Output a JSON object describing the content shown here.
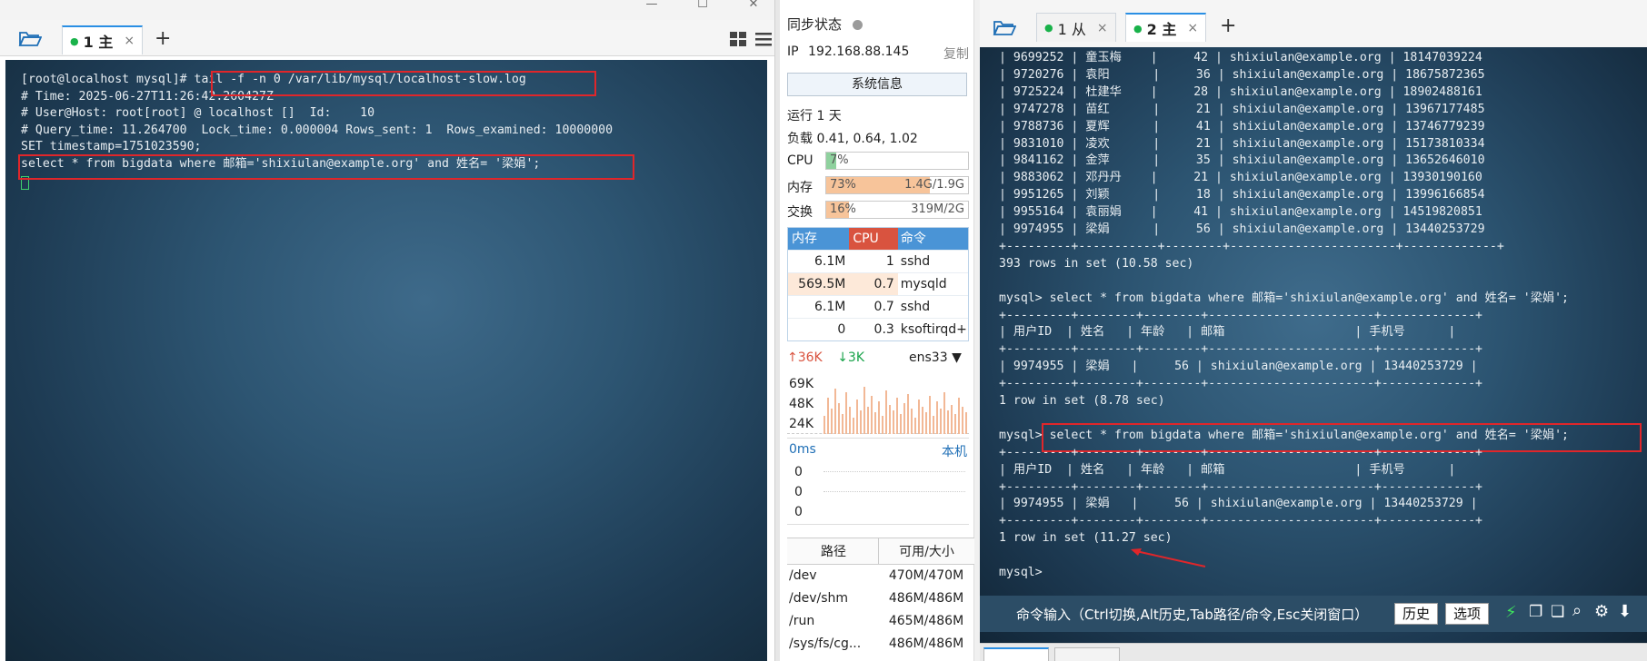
{
  "left": {
    "tab": {
      "label": "1 主",
      "close": "×"
    },
    "plus": "+",
    "lines": [
      "[root@localhost mysql]# tail -f -n 0 /var/lib/mysql/localhost-slow.log",
      "# Time: 2025-06-27T11:26:42.260427Z",
      "# User@Host: root[root] @ localhost []  Id:    10",
      "# Query_time: 11.264700  Lock_time: 0.000004 Rows_sent: 1  Rows_examined: 10000000",
      "SET timestamp=1751023590;",
      "select * from bigdata where 邮箱='shixiulan@example.org' and 姓名= '梁娟';"
    ]
  },
  "mid": {
    "sync_label": "同步状态",
    "ip_label": "IP",
    "ip": "192.168.88.145",
    "copy": "复制",
    "sysinfo_button": "系统信息",
    "uptime": "运行 1 天",
    "load": "负载 0.41, 0.64, 1.02",
    "cpu": {
      "label": "CPU",
      "pct": "7%",
      "fill": 0.07
    },
    "mem": {
      "label": "内存",
      "pct": "73%",
      "detail": "1.4G/1.9G",
      "fill": 0.73
    },
    "swap": {
      "label": "交换",
      "pct": "16%",
      "detail": "319M/2G",
      "fill": 0.16
    },
    "proc_headers": [
      "内存",
      "CPU",
      "命令"
    ],
    "procs": [
      {
        "mem": "6.1M",
        "cpu": "1",
        "cmd": "sshd"
      },
      {
        "mem": "569.5M",
        "cpu": "0.7",
        "cmd": "mysqld"
      },
      {
        "mem": "6.1M",
        "cpu": "0.7",
        "cmd": "sshd"
      },
      {
        "mem": "0",
        "cpu": "0.3",
        "cmd": "ksoftirqd+"
      }
    ],
    "net": {
      "up": "36K",
      "down": "3K",
      "iface": "ens33",
      "ticks": [
        "69K",
        "48K",
        "24K"
      ]
    },
    "latency": {
      "label": "0ms",
      "host": "本机",
      "values": [
        "0",
        "0",
        "0"
      ]
    },
    "disk_headers": [
      "路径",
      "可用/大小"
    ],
    "disks": [
      {
        "path": "/dev",
        "size": "470M/470M"
      },
      {
        "path": "/dev/shm",
        "size": "486M/486M"
      },
      {
        "path": "/run",
        "size": "465M/486M"
      },
      {
        "path": "/sys/fs/cg...",
        "size": "486M/486M"
      }
    ]
  },
  "right": {
    "tabs": [
      {
        "label": "1 从",
        "close": "×"
      },
      {
        "label": "2 主",
        "close": "×"
      }
    ],
    "plus": "+",
    "lines": [
      "| 9699252 | 童玉梅    |     42 | shixiulan@example.org | 18147039224",
      "| 9720276 | 袁阳      |     36 | shixiulan@example.org | 18675872365",
      "| 9725224 | 杜建华    |     28 | shixiulan@example.org | 18902488161",
      "| 9747278 | 苗红      |     21 | shixiulan@example.org | 13967177485",
      "| 9788736 | 夏辉      |     41 | shixiulan@example.org | 13746779239",
      "| 9831010 | 凌欢      |     21 | shixiulan@example.org | 15173810334",
      "| 9841162 | 金萍      |     35 | shixiulan@example.org | 13652646010",
      "| 9883062 | 邓丹丹    |     21 | shixiulan@example.org | 13930190160",
      "| 9951265 | 刘颖      |     18 | shixiulan@example.org | 13996166854",
      "| 9955164 | 袁丽娟    |     41 | shixiulan@example.org | 14519820851",
      "| 9974955 | 梁娟      |     56 | shixiulan@example.org | 13440253729",
      "+---------+-----------+--------+-----------------------+-------------+",
      "393 rows in set (10.58 sec)",
      "",
      "mysql> select * from bigdata where 邮箱='shixiulan@example.org' and 姓名= '梁娟';",
      "+---------+--------+--------+-----------------------+-------------+",
      "| 用户ID  | 姓名   | 年龄   | 邮箱                  | 手机号      |",
      "+---------+--------+--------+-----------------------+-------------+",
      "| 9974955 | 梁娟   |     56 | shixiulan@example.org | 13440253729 |",
      "+---------+--------+--------+-----------------------+-------------+",
      "1 row in set (8.78 sec)",
      "",
      "mysql> select * from bigdata where 邮箱='shixiulan@example.org' and 姓名= '梁娟';",
      "+---------+--------+--------+-----------------------+-------------+",
      "| 用户ID  | 姓名   | 年龄   | 邮箱                  | 手机号      |",
      "+---------+--------+--------+-----------------------+-------------+",
      "| 9974955 | 梁娟   |     56 | shixiulan@example.org | 13440253729 |",
      "+---------+--------+--------+-----------------------+-------------+",
      "1 row in set (11.27 sec)",
      "",
      "mysql>"
    ],
    "cmd_placeholder": "命令输入（Ctrl切换,Alt历史,Tab路径/命令,Esc关闭窗口）",
    "history_button": "历史",
    "options_button": "选项"
  }
}
